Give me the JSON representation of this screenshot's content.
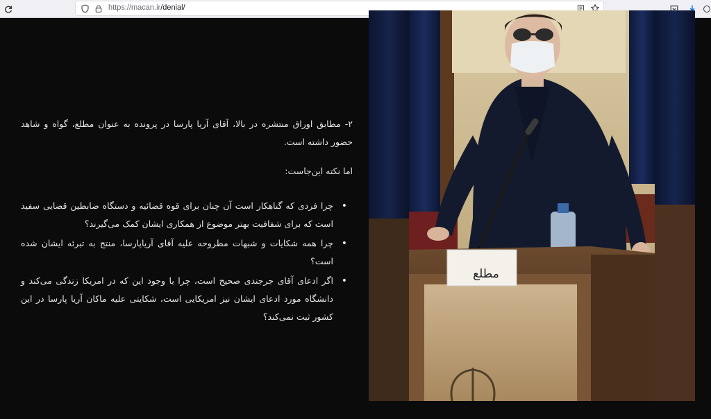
{
  "browser": {
    "url_host": "https://macan.ir",
    "url_path": "/denial/"
  },
  "article": {
    "para1": "۲- مطابق اوراق منتشره در بالا، آقای آریا پارسا در پرونده به عنوان مطلع، گواه و شاهد حضور داشته است.",
    "para2": "اما نکته این‌جاست:",
    "bullets": [
      "چرا فردی که گناهکار است آن چنان برای قوه قضائیه و دستگاه ضابطین قضایی سفید است که برای شفافیت بهتر موضوع از همکاری ایشان کمک می‌گیرند؟",
      "چرا همه شکایات و شبهات مطروحه علیه آقای آریاپارسا، منتج به تبرئه ایشان شده است؟",
      "اگر ادعای آقای جرجندی صحیح است، چرا با وجود این که در امریکا زندگی می‌کند و دانشگاه مورد ادعای ایشان نیز امریکایی است، شکایتی علیه ماکان آریا پارسا در این کشور ثبت نمی‌کند؟"
    ]
  },
  "video": {
    "sign_label": "مطلع"
  },
  "icons": {
    "reload": "reload-icon",
    "shield": "shield-icon",
    "lock": "lock-icon",
    "reader": "reader-view-icon",
    "bookmark": "bookmark-star-icon",
    "pocket": "pocket-icon",
    "download": "download-icon",
    "account": "account-icon"
  }
}
